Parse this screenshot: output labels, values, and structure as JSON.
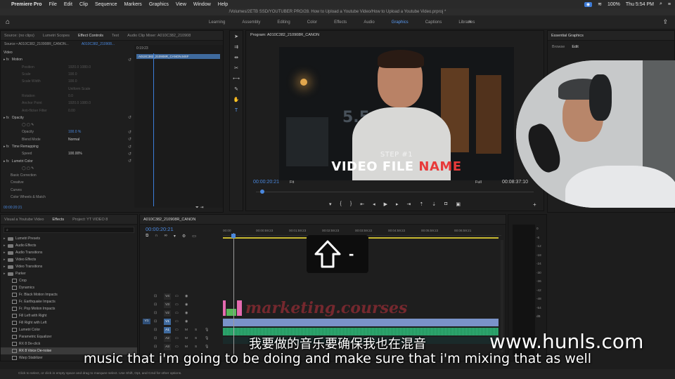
{
  "menubar": {
    "app": "Premiere Pro",
    "items": [
      "File",
      "Edit",
      "Clip",
      "Sequence",
      "Markers",
      "Graphics",
      "View",
      "Window",
      "Help"
    ],
    "battery": "100%",
    "clock": "Thu 5:54 PM"
  },
  "window_title": "/Volumes/2ETB SSD/YOUTUBER PRO/28. How to Upload a Youtube Video/How to Upload a Youtube Video.prproj *",
  "workspaces": [
    "Learning",
    "Assembly",
    "Editing",
    "Color",
    "Effects",
    "Audio",
    "Graphics",
    "Captions",
    "Libraries"
  ],
  "workspace_active": "Graphics",
  "effect_controls": {
    "tabs": [
      "Source: (no clips)",
      "Lumetri Scopes",
      "Effect Controls",
      "Text",
      "Audio Clip Mixer: A010C382_210908"
    ],
    "active_tab": "Effect Controls",
    "source_left": "Source • A010C382_210908R_CANON...",
    "source_right": "A010C382_210908...",
    "time": "0:19:23",
    "clip_name": "A010C382_210908R_CANON.MXF",
    "rows": [
      {
        "label": "Video",
        "type": "head"
      },
      {
        "label": "Motion",
        "type": "fx",
        "val": ""
      },
      {
        "label": "Position",
        "type": "prop",
        "val": "1920.0   1080.0"
      },
      {
        "label": "Scale",
        "type": "prop",
        "val": "100.0"
      },
      {
        "label": "Scale Width",
        "type": "prop",
        "val": "100.0"
      },
      {
        "label": "",
        "type": "prop",
        "val": "Uniform Scale"
      },
      {
        "label": "Rotation",
        "type": "prop",
        "val": "0.0"
      },
      {
        "label": "Anchor Point",
        "type": "prop",
        "val": "1920.0   1080.0"
      },
      {
        "label": "Anti-flicker Filter",
        "type": "prop",
        "val": "0.00"
      },
      {
        "label": "Opacity",
        "type": "fx",
        "val": ""
      },
      {
        "label": "",
        "type": "shapes",
        "val": ""
      },
      {
        "label": "Opacity",
        "type": "propblue",
        "val": "100.0 %"
      },
      {
        "label": "Blend Mode",
        "type": "propwhite",
        "val": "Normal"
      },
      {
        "label": "Time Remapping",
        "type": "fx",
        "val": ""
      },
      {
        "label": "Speed",
        "type": "propwhite",
        "val": "100.00%"
      },
      {
        "label": "Lumetri Color",
        "type": "fx",
        "val": ""
      },
      {
        "label": "",
        "type": "shapes",
        "val": ""
      },
      {
        "label": "Basic Correction",
        "type": "sub",
        "val": ""
      },
      {
        "label": "Creative",
        "type": "sub",
        "val": ""
      },
      {
        "label": "Curves",
        "type": "sub",
        "val": ""
      },
      {
        "label": "Color Wheels & Match",
        "type": "sub",
        "val": ""
      }
    ],
    "footer_time": "00:00:20:21"
  },
  "program": {
    "title": "Program: A010C382_210908R_CANON",
    "step": "STEP #1",
    "name_white": "VIDEO FILE ",
    "name_red": "NAME",
    "bg_number": "5.5",
    "timecode": "00:00:20:21",
    "fit": "Fit",
    "full": "Full",
    "duration": "00:08:37:10"
  },
  "essential_graphics": {
    "title": "Essential Graphics",
    "tabs": [
      "Browse",
      "Edit"
    ],
    "active_tab": "Edit"
  },
  "project": {
    "tabs": [
      "Visual a Youtube Video",
      "Effects",
      "Project: YT VIDEO 8"
    ],
    "active_tab": "Effects",
    "items": [
      {
        "label": "Lumetri Presets",
        "kind": "folder"
      },
      {
        "label": "Audio Effects",
        "kind": "folder"
      },
      {
        "label": "Audio Transitions",
        "kind": "folder"
      },
      {
        "label": "Video Effects",
        "kind": "folder"
      },
      {
        "label": "Video Transitions",
        "kind": "folder"
      },
      {
        "label": "Parker",
        "kind": "folder"
      },
      {
        "label": "Crop",
        "kind": "fx"
      },
      {
        "label": "Dynamics",
        "kind": "fx"
      },
      {
        "label": "Fr. Black Motion Impacts",
        "kind": "fx"
      },
      {
        "label": "Fr. Earthquake Impacts",
        "kind": "fx"
      },
      {
        "label": "Fr. Pop Motion Impacts",
        "kind": "fx"
      },
      {
        "label": "Fill Left with Right",
        "kind": "fx"
      },
      {
        "label": "Fill Right with Left",
        "kind": "fx"
      },
      {
        "label": "Lumetri Color",
        "kind": "fx"
      },
      {
        "label": "Parametric Equalizer",
        "kind": "fx"
      },
      {
        "label": "RX 8 De-click",
        "kind": "fx"
      },
      {
        "label": "RX 8 Voice De-noise",
        "kind": "fx",
        "selected": true
      },
      {
        "label": "Warp Stabilizer",
        "kind": "fx"
      }
    ]
  },
  "timeline": {
    "tab": "A010C382_210908R_CANON",
    "timecode": "00:00:20:21",
    "ruler": [
      "00:00",
      "00:00:59:23",
      "00:01:59:23",
      "00:02:59:23",
      "00:03:59:22",
      "00:04:59:22",
      "00:05:59:22",
      "00:06:59:21",
      "00:07:59:21"
    ],
    "tracks": [
      {
        "name": "V4"
      },
      {
        "name": "V3"
      },
      {
        "name": "V2"
      },
      {
        "name": "V1",
        "on": true
      },
      {
        "name": "A1",
        "on": true
      },
      {
        "name": "A2"
      },
      {
        "name": "A3"
      }
    ],
    "source_patch": "V1",
    "watermark": "marketing.courses"
  },
  "meter_scale": [
    "0",
    "-6",
    "-12",
    "-18",
    "-24",
    "-30",
    "-36",
    "-42",
    "-48",
    "-54",
    "dB"
  ],
  "overlay_key": "-",
  "status": "Click to select, or click in empty space and drag to marquee select. Use Shift, Opt, and Cmd for other options.",
  "subtitles": {
    "chinese": "我要做的音乐要确保我也在混音",
    "english": "music that i'm going to be doing and make sure that i'm mixing that as well"
  },
  "site_watermark": "www.hunls.com"
}
